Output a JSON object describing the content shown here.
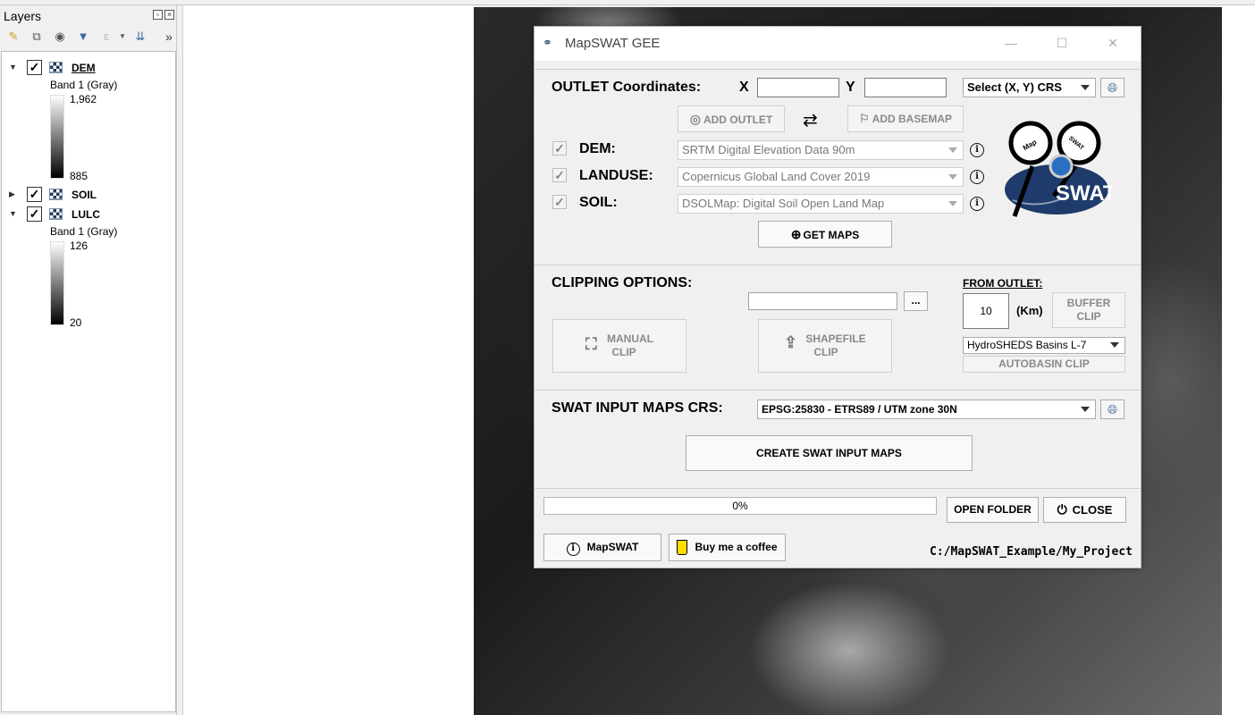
{
  "layers_panel": {
    "title": "Layers",
    "layers": [
      {
        "name": "DEM",
        "checked": true,
        "expanded": true,
        "band": "Band 1 (Gray)",
        "max": "1,962",
        "min": "885"
      },
      {
        "name": "SOIL",
        "checked": true,
        "expanded": false
      },
      {
        "name": "LULC",
        "checked": true,
        "expanded": true,
        "band": "Band 1 (Gray)",
        "max": "126",
        "min": "20"
      }
    ],
    "toolbar_icons": [
      "style-icon",
      "add-group-icon",
      "eye-icon",
      "filter-icon",
      "expression-filter-icon",
      "collapse-icon",
      "more-icon"
    ]
  },
  "dialog": {
    "title": "MapSWAT GEE",
    "outlet": {
      "label": "OUTLET Coordinates:",
      "x_label": "X",
      "y_label": "Y",
      "x_value": "",
      "y_value": "",
      "crs_select": "Select (X, Y) CRS",
      "add_outlet": "ADD OUTLET",
      "add_basemap": "ADD BASEMAP"
    },
    "datasets": [
      {
        "label": "DEM:",
        "value": "SRTM Digital Elevation Data 90m",
        "checked": true
      },
      {
        "label": "LANDUSE:",
        "value": "Copernicus Global Land Cover 2019",
        "checked": true
      },
      {
        "label": "SOIL:",
        "value": "DSOLMap: Digital Soil Open Land Map",
        "checked": true
      }
    ],
    "get_maps": "GET MAPS",
    "logo": {
      "map_text": "Map",
      "swat_text": "SWAT",
      "big_text": "SWAT"
    },
    "clipping": {
      "label": "CLIPPING OPTIONS:",
      "path_value": "",
      "browse": "...",
      "manual_clip_line1": "MANUAL",
      "manual_clip_line2": "CLIP",
      "shapefile_clip_line1": "SHAPEFILE",
      "shapefile_clip_line2": "CLIP",
      "from_outlet": "FROM OUTLET:",
      "buffer_value": "10",
      "buffer_unit": "(Km)",
      "buffer_clip_line1": "BUFFER",
      "buffer_clip_line2": "CLIP",
      "basin_select": "HydroSHEDS Basins L-7",
      "autobasin_clip": "AUTOBASIN CLIP"
    },
    "crs": {
      "label": "SWAT INPUT MAPS CRS:",
      "value": "EPSG:25830 - ETRS89 / UTM zone 30N"
    },
    "create_button": "CREATE SWAT INPUT MAPS",
    "progress": {
      "value": 0,
      "text": "0%"
    },
    "open_folder": "OPEN FOLDER",
    "close": "CLOSE",
    "about": "MapSWAT",
    "coffee": "Buy me a coffee",
    "project_path": "C:/MapSWAT_Example/My_Project"
  }
}
